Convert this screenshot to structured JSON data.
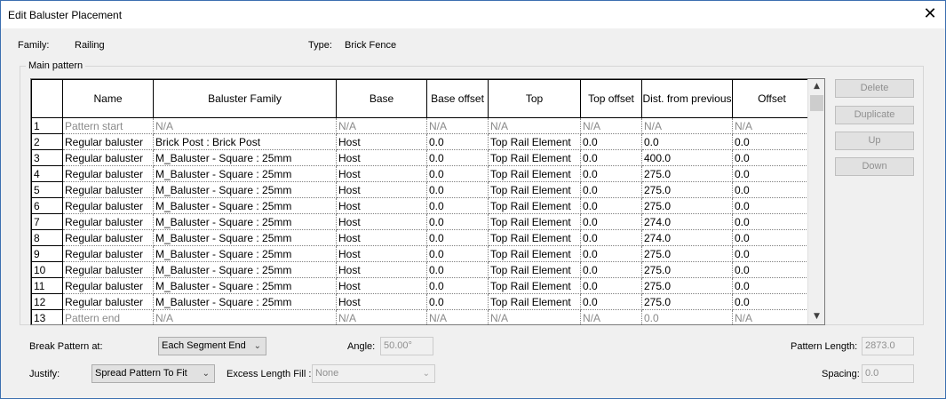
{
  "window": {
    "title": "Edit Baluster Placement"
  },
  "family": {
    "label": "Family:",
    "value": "Railing"
  },
  "type": {
    "label": "Type:",
    "value": "Brick Fence"
  },
  "main_pattern": {
    "caption": "Main pattern",
    "columns": [
      "",
      "Name",
      "Baluster Family",
      "Base",
      "Base offset",
      "Top",
      "Top offset",
      "Dist. from previous",
      "Offset"
    ],
    "rows": [
      [
        "1",
        "Pattern start",
        "N/A",
        "N/A",
        "N/A",
        "N/A",
        "N/A",
        "N/A",
        "N/A"
      ],
      [
        "2",
        "Regular baluster",
        "Brick Post : Brick Post",
        "Host",
        "0.0",
        "Top Rail Element",
        "0.0",
        "0.0",
        "0.0"
      ],
      [
        "3",
        "Regular baluster",
        "M_Baluster - Square : 25mm",
        "Host",
        "0.0",
        "Top Rail Element",
        "0.0",
        "400.0",
        "0.0"
      ],
      [
        "4",
        "Regular baluster",
        "M_Baluster - Square : 25mm",
        "Host",
        "0.0",
        "Top Rail Element",
        "0.0",
        "275.0",
        "0.0"
      ],
      [
        "5",
        "Regular baluster",
        "M_Baluster - Square : 25mm",
        "Host",
        "0.0",
        "Top Rail Element",
        "0.0",
        "275.0",
        "0.0"
      ],
      [
        "6",
        "Regular baluster",
        "M_Baluster - Square : 25mm",
        "Host",
        "0.0",
        "Top Rail Element",
        "0.0",
        "275.0",
        "0.0"
      ],
      [
        "7",
        "Regular baluster",
        "M_Baluster - Square : 25mm",
        "Host",
        "0.0",
        "Top Rail Element",
        "0.0",
        "274.0",
        "0.0"
      ],
      [
        "8",
        "Regular baluster",
        "M_Baluster - Square : 25mm",
        "Host",
        "0.0",
        "Top Rail Element",
        "0.0",
        "274.0",
        "0.0"
      ],
      [
        "9",
        "Regular baluster",
        "M_Baluster - Square : 25mm",
        "Host",
        "0.0",
        "Top Rail Element",
        "0.0",
        "275.0",
        "0.0"
      ],
      [
        "10",
        "Regular baluster",
        "M_Baluster - Square : 25mm",
        "Host",
        "0.0",
        "Top Rail Element",
        "0.0",
        "275.0",
        "0.0"
      ],
      [
        "11",
        "Regular baluster",
        "M_Baluster - Square : 25mm",
        "Host",
        "0.0",
        "Top Rail Element",
        "0.0",
        "275.0",
        "0.0"
      ],
      [
        "12",
        "Regular baluster",
        "M_Baluster - Square : 25mm",
        "Host",
        "0.0",
        "Top Rail Element",
        "0.0",
        "275.0",
        "0.0"
      ],
      [
        "13",
        "Pattern end",
        "N/A",
        "N/A",
        "N/A",
        "N/A",
        "N/A",
        "0.0",
        "N/A"
      ]
    ],
    "gray_rows": [
      0,
      12
    ]
  },
  "buttons": {
    "delete": "Delete",
    "duplicate": "Duplicate",
    "up": "Up",
    "down": "Down"
  },
  "break_pattern": {
    "label": "Break Pattern at:",
    "value": "Each Segment End"
  },
  "angle": {
    "label": "Angle:",
    "value": "50.00°"
  },
  "pattern_length": {
    "label": "Pattern Length:",
    "value": "2873.0"
  },
  "justify": {
    "label": "Justify:",
    "value": "Spread Pattern To Fit"
  },
  "excess_length_fill": {
    "label": "Excess Length Fill :",
    "value": "None"
  },
  "spacing": {
    "label": "Spacing:",
    "value": "0.0"
  },
  "icons": {
    "close": "close-icon",
    "scroll_up": "scroll-up-icon",
    "scroll_down": "scroll-down-icon",
    "dropdown": "chevron-down-icon"
  }
}
